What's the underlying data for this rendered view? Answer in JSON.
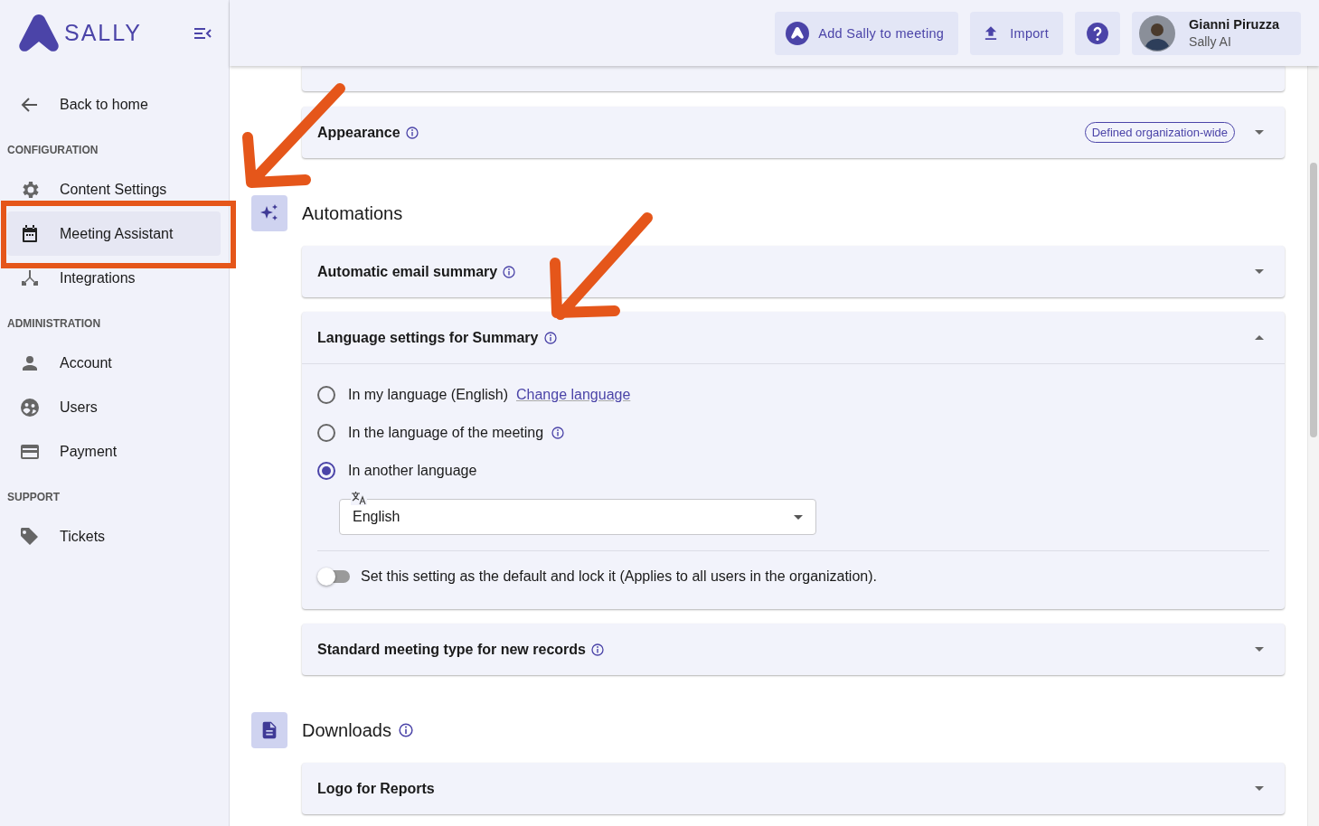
{
  "sidebar": {
    "logo": "SALLY",
    "back": "Back to home",
    "sections": [
      {
        "title": "CONFIGURATION",
        "items": [
          {
            "label": "Content Settings",
            "selected": false
          },
          {
            "label": "Meeting Assistant",
            "selected": true
          },
          {
            "label": "Integrations",
            "selected": false
          }
        ]
      },
      {
        "title": "ADMINISTRATION",
        "items": [
          {
            "label": "Account",
            "selected": false
          },
          {
            "label": "Users",
            "selected": false
          },
          {
            "label": "Payment",
            "selected": false
          }
        ]
      },
      {
        "title": "SUPPORT",
        "items": [
          {
            "label": "Tickets",
            "selected": false
          }
        ]
      }
    ]
  },
  "header": {
    "buttons": [
      "Add Sally to meeting",
      "Import"
    ],
    "user": {
      "name": "Gianni Piruzza",
      "org": "Sally AI"
    }
  },
  "top_panels": [
    {
      "title": "Appearance",
      "info": true,
      "badge": "Defined organization-wide",
      "expanded": false
    }
  ],
  "sections": [
    {
      "title": "Automations",
      "info": false,
      "panels": [
        {
          "title": "Automatic email summary",
          "info": true,
          "expanded": false
        },
        {
          "title": "Language settings for Summary",
          "info": true,
          "expanded": true,
          "options": [
            {
              "label": "In my language (English)",
              "link": "Change language",
              "info": false,
              "selected": false
            },
            {
              "label": "In the language of the meeting",
              "info": true,
              "selected": false
            },
            {
              "label": "In another language",
              "info": false,
              "selected": true
            }
          ],
          "language_select": {
            "value": "English"
          },
          "lock_toggle": {
            "label": "Set this setting as the default and lock it (Applies to all users in the organization).",
            "on": false
          }
        },
        {
          "title": "Standard meeting type for new records",
          "info": true,
          "expanded": false
        }
      ]
    },
    {
      "title": "Downloads",
      "info": true,
      "panels": [
        {
          "title": "Logo for Reports",
          "info": false,
          "expanded": false
        }
      ]
    }
  ]
}
